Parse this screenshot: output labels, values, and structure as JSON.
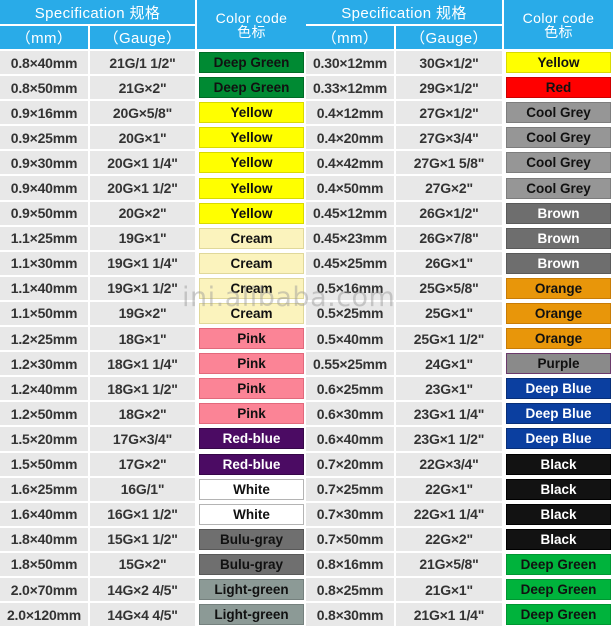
{
  "headers": {
    "spec": "Specification  规格",
    "mm": "（mm）",
    "gauge": "（Gauge）",
    "color_line1": "Color code",
    "color_line2": "色标"
  },
  "watermark": "ini.alibaba.com",
  "palette": {
    "header_blue": "#29abe8",
    "cell_gray": "#e8e8e8",
    "deep_green_dark": "#008a33",
    "deep_green_bright": "#00b33c",
    "yellow": "#ffff00",
    "cream": "#fbf3bd",
    "pink": "#fb8496",
    "red_blue": "#4b0b63",
    "white": "#ffffff",
    "bulu_gray": "#6f6f6f",
    "light_green": "#8c9a96",
    "red": "#ff0000",
    "cool_grey": "#969696",
    "brown": "#6e6e6e",
    "orange": "#e8960a",
    "purple": "#8a8a8a",
    "deep_blue": "#0b3fa0",
    "black": "#121212"
  },
  "left_table": [
    {
      "mm": "0.8×40mm",
      "gauge": "21G/1 1/2\"",
      "color": "Deep Green",
      "bg": "#008a33",
      "fg": "#111111",
      "border": "#006b26"
    },
    {
      "mm": "0.8×50mm",
      "gauge": "21G×2\"",
      "color": "Deep Green",
      "bg": "#008a33",
      "fg": "#111111",
      "border": "#006b26"
    },
    {
      "mm": "0.9×16mm",
      "gauge": "20G×5/8\"",
      "color": "Yellow",
      "bg": "#ffff00",
      "fg": "#111111",
      "border": "#d9d900"
    },
    {
      "mm": "0.9×25mm",
      "gauge": "20G×1\"",
      "color": "Yellow",
      "bg": "#ffff00",
      "fg": "#111111",
      "border": "#d9d900"
    },
    {
      "mm": "0.9×30mm",
      "gauge": "20G×1 1/4\"",
      "color": "Yellow",
      "bg": "#ffff00",
      "fg": "#111111",
      "border": "#d9d900"
    },
    {
      "mm": "0.9×40mm",
      "gauge": "20G×1 1/2\"",
      "color": "Yellow",
      "bg": "#ffff00",
      "fg": "#111111",
      "border": "#d9d900"
    },
    {
      "mm": "0.9×50mm",
      "gauge": "20G×2\"",
      "color": "Yellow",
      "bg": "#ffff00",
      "fg": "#111111",
      "border": "#d9d900"
    },
    {
      "mm": "1.1×25mm",
      "gauge": "19G×1\"",
      "color": "Cream",
      "bg": "#fbf3bd",
      "fg": "#111111",
      "border": "#e0d89a"
    },
    {
      "mm": "1.1×30mm",
      "gauge": "19G×1 1/4\"",
      "color": "Cream",
      "bg": "#fbf3bd",
      "fg": "#111111",
      "border": "#e0d89a"
    },
    {
      "mm": "1.1×40mm",
      "gauge": "19G×1 1/2\"",
      "color": "Cream",
      "bg": "#fbf3bd",
      "fg": "#111111",
      "border": "#e0d89a"
    },
    {
      "mm": "1.1×50mm",
      "gauge": "19G×2\"",
      "color": "Cream",
      "bg": "#fbf3bd",
      "fg": "#111111",
      "border": "#e0d89a"
    },
    {
      "mm": "1.2×25mm",
      "gauge": "18G×1\"",
      "color": "Pink",
      "bg": "#fb8496",
      "fg": "#111111",
      "border": "#e2697c"
    },
    {
      "mm": "1.2×30mm",
      "gauge": "18G×1 1/4\"",
      "color": "Pink",
      "bg": "#fb8496",
      "fg": "#111111",
      "border": "#e2697c"
    },
    {
      "mm": "1.2×40mm",
      "gauge": "18G×1 1/2\"",
      "color": "Pink",
      "bg": "#fb8496",
      "fg": "#111111",
      "border": "#e2697c"
    },
    {
      "mm": "1.2×50mm",
      "gauge": "18G×2\"",
      "color": "Pink",
      "bg": "#fb8496",
      "fg": "#111111",
      "border": "#e2697c"
    },
    {
      "mm": "1.5×20mm",
      "gauge": "17G×3/4\"",
      "color": "Red-blue",
      "bg": "#4b0b63",
      "fg": "#ffffff",
      "border": "#360848"
    },
    {
      "mm": "1.5×50mm",
      "gauge": "17G×2\"",
      "color": "Red-blue",
      "bg": "#4b0b63",
      "fg": "#ffffff",
      "border": "#360848"
    },
    {
      "mm": "1.6×25mm",
      "gauge": "16G/1\"",
      "color": "White",
      "bg": "#ffffff",
      "fg": "#111111",
      "border": "#b4b4b4"
    },
    {
      "mm": "1.6×40mm",
      "gauge": "16G×1 1/2\"",
      "color": "White",
      "bg": "#ffffff",
      "fg": "#111111",
      "border": "#b4b4b4"
    },
    {
      "mm": "1.8×40mm",
      "gauge": "15G×1 1/2\"",
      "color": "Bulu-gray",
      "bg": "#6f6f6f",
      "fg": "#111111",
      "border": "#595959"
    },
    {
      "mm": "1.8×50mm",
      "gauge": "15G×2\"",
      "color": "Bulu-gray",
      "bg": "#6f6f6f",
      "fg": "#111111",
      "border": "#595959"
    },
    {
      "mm": "2.0×70mm",
      "gauge": "14G×2 4/5\"",
      "color": "Light-green",
      "bg": "#8c9a96",
      "fg": "#111111",
      "border": "#75817e"
    },
    {
      "mm": "2.0×120mm",
      "gauge": "14G×4 4/5\"",
      "color": "Light-green",
      "bg": "#8c9a96",
      "fg": "#111111",
      "border": "#75817e"
    }
  ],
  "right_table": [
    {
      "mm": "0.30×12mm",
      "gauge": "30G×1/2\"",
      "color": "Yellow",
      "bg": "#ffff00",
      "fg": "#111111",
      "border": "#d9d900"
    },
    {
      "mm": "0.33×12mm",
      "gauge": "29G×1/2\"",
      "color": "Red",
      "bg": "#ff0000",
      "fg": "#111111",
      "border": "#cc0000"
    },
    {
      "mm": "0.4×12mm",
      "gauge": "27G×1/2\"",
      "color": "Cool Grey",
      "bg": "#969696",
      "fg": "#111111",
      "border": "#7d7d7d"
    },
    {
      "mm": "0.4×20mm",
      "gauge": "27G×3/4\"",
      "color": "Cool Grey",
      "bg": "#969696",
      "fg": "#111111",
      "border": "#7d7d7d"
    },
    {
      "mm": "0.4×42mm",
      "gauge": "27G×1 5/8\"",
      "color": "Cool Grey",
      "bg": "#969696",
      "fg": "#111111",
      "border": "#7d7d7d"
    },
    {
      "mm": "0.4×50mm",
      "gauge": "27G×2\"",
      "color": "Cool Grey",
      "bg": "#969696",
      "fg": "#111111",
      "border": "#7d7d7d"
    },
    {
      "mm": "0.45×12mm",
      "gauge": "26G×1/2\"",
      "color": "Brown",
      "bg": "#6e6e6e",
      "fg": "#ffffff",
      "border": "#5a5a5a"
    },
    {
      "mm": "0.45×23mm",
      "gauge": "26G×7/8\"",
      "color": "Brown",
      "bg": "#6e6e6e",
      "fg": "#ffffff",
      "border": "#5a5a5a"
    },
    {
      "mm": "0.45×25mm",
      "gauge": "26G×1\"",
      "color": "Brown",
      "bg": "#6e6e6e",
      "fg": "#ffffff",
      "border": "#5a5a5a"
    },
    {
      "mm": "0.5×16mm",
      "gauge": "25G×5/8\"",
      "color": "Orange",
      "bg": "#e8960a",
      "fg": "#111111",
      "border": "#c87c06"
    },
    {
      "mm": "0.5×25mm",
      "gauge": "25G×1\"",
      "color": "Orange",
      "bg": "#e8960a",
      "fg": "#111111",
      "border": "#c87c06"
    },
    {
      "mm": "0.5×40mm",
      "gauge": "25G×1 1/2\"",
      "color": "Orange",
      "bg": "#e8960a",
      "fg": "#111111",
      "border": "#c87c06"
    },
    {
      "mm": "0.55×25mm",
      "gauge": "24G×1\"",
      "color": "Purple",
      "bg": "#8a8a8a",
      "fg": "#111111",
      "border": "#6b3a6b"
    },
    {
      "mm": "0.6×25mm",
      "gauge": "23G×1\"",
      "color": "Deep Blue",
      "bg": "#0b3fa0",
      "fg": "#ffffff",
      "border": "#082f78"
    },
    {
      "mm": "0.6×30mm",
      "gauge": "23G×1 1/4\"",
      "color": "Deep Blue",
      "bg": "#0b3fa0",
      "fg": "#ffffff",
      "border": "#082f78"
    },
    {
      "mm": "0.6×40mm",
      "gauge": "23G×1 1/2\"",
      "color": "Deep Blue",
      "bg": "#0b3fa0",
      "fg": "#ffffff",
      "border": "#082f78"
    },
    {
      "mm": "0.7×20mm",
      "gauge": "22G×3/4\"",
      "color": "Black",
      "bg": "#121212",
      "fg": "#ffffff",
      "border": "#000000"
    },
    {
      "mm": "0.7×25mm",
      "gauge": "22G×1\"",
      "color": "Black",
      "bg": "#121212",
      "fg": "#ffffff",
      "border": "#000000"
    },
    {
      "mm": "0.7×30mm",
      "gauge": "22G×1 1/4\"",
      "color": "Black",
      "bg": "#121212",
      "fg": "#ffffff",
      "border": "#000000"
    },
    {
      "mm": "0.7×50mm",
      "gauge": "22G×2\"",
      "color": "Black",
      "bg": "#121212",
      "fg": "#ffffff",
      "border": "#000000"
    },
    {
      "mm": "0.8×16mm",
      "gauge": "21G×5/8\"",
      "color": "Deep Green",
      "bg": "#00b33c",
      "fg": "#111111",
      "border": "#009632"
    },
    {
      "mm": "0.8×25mm",
      "gauge": "21G×1\"",
      "color": "Deep Green",
      "bg": "#00b33c",
      "fg": "#111111",
      "border": "#009632"
    },
    {
      "mm": "0.8×30mm",
      "gauge": "21G×1 1/4\"",
      "color": "Deep Green",
      "bg": "#00b33c",
      "fg": "#111111",
      "border": "#009632"
    }
  ]
}
